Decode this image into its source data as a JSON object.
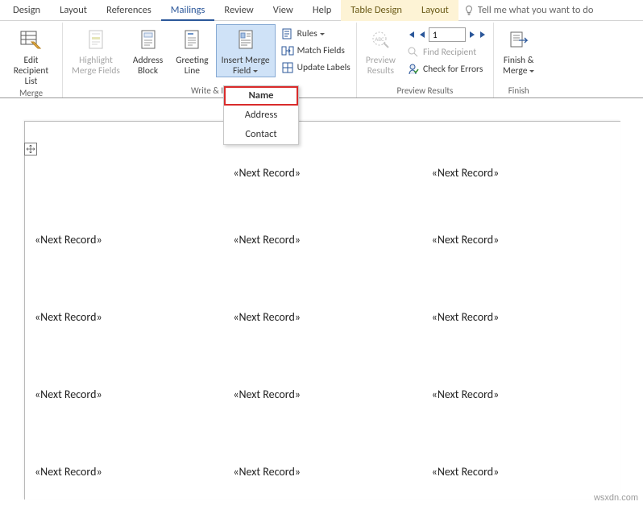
{
  "tabs": {
    "design": "Design",
    "layout": "Layout",
    "references": "References",
    "mailings": "Mailings",
    "review": "Review",
    "view": "View",
    "help": "Help",
    "tabledesign": "Table Design",
    "layout2": "Layout",
    "tellme": "Tell me what you want to do"
  },
  "ribbon": {
    "editRecipient": "Edit\nRecipient List",
    "highlight": "Highlight\nMerge Fields",
    "addressBlock": "Address\nBlock",
    "greeting": "Greeting\nLine",
    "insertMerge": "Insert Merge\nField",
    "rules": "Rules",
    "matchFields": "Match Fields",
    "updateLabels": "Update Labels",
    "preview": "Preview\nResults",
    "findRecipient": "Find Recipient",
    "checkErrors": "Check for Errors",
    "finishMerge": "Finish &\nMerge",
    "navValue": "1",
    "groups": {
      "merge": "Merge",
      "write": "Write & In",
      "preview": "Preview Results",
      "finish": "Finish"
    }
  },
  "dropdown": {
    "name": "Name",
    "address": "Address",
    "contact": "Contact"
  },
  "document": {
    "nextRecord": "«Next Record»"
  },
  "watermark": "wsxdn.com"
}
